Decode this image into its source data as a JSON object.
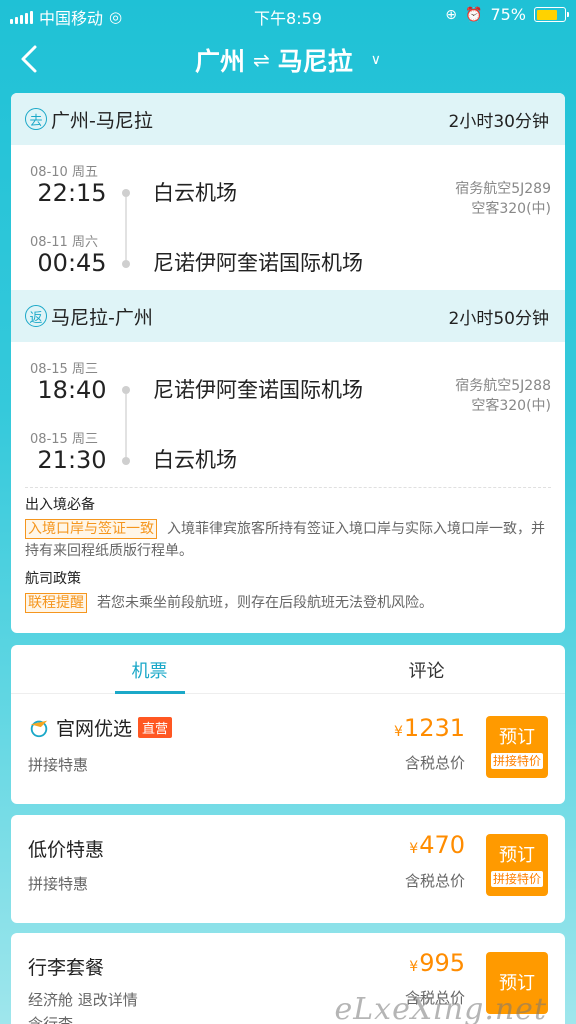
{
  "status_bar": {
    "carrier": "中国移动",
    "time": "下午8:59",
    "battery": "75%",
    "battery_level": 0.75
  },
  "nav": {
    "origin": "广州",
    "swap_icon": "⇌",
    "destination": "马尼拉",
    "dropdown_icon": "∨"
  },
  "outbound": {
    "badge": "去",
    "route": "广州-马尼拉",
    "duration": "2小时30分钟",
    "dep_date": "08-10 周五",
    "dep_time": "22:15",
    "dep_airport": "白云机场",
    "arr_date": "08-11 周六",
    "arr_time": "00:45",
    "arr_airport": "尼诺伊阿奎诺国际机场",
    "carrier": "宿务航空5J289",
    "aircraft": "空客320(中)"
  },
  "inbound": {
    "badge": "返",
    "route": "马尼拉-广州",
    "duration": "2小时50分钟",
    "dep_date": "08-15 周三",
    "dep_time": "18:40",
    "dep_airport": "尼诺伊阿奎诺国际机场",
    "arr_date": "08-15 周三",
    "arr_time": "21:30",
    "arr_airport": "白云机场",
    "carrier": "宿务航空5J288",
    "aircraft": "空客320(中)"
  },
  "notes": {
    "entry_title": "出入境必备",
    "entry_tag": "入境口岸与签证一致",
    "entry_text": "入境菲律宾旅客所持有签证入境口岸与实际入境口岸一致，并持有来回程纸质版行程单。",
    "policy_title": "航司政策",
    "policy_tag": "联程提醒",
    "policy_text": "若您未乘坐前段航班，则存在后段航班无法登机风险。"
  },
  "tabs": {
    "tickets": "机票",
    "reviews": "评论"
  },
  "products": [
    {
      "name": "官网优选",
      "badge": "直营",
      "sub": "拼接特惠",
      "currency": "¥",
      "price": "1231",
      "tax_note": "含税总价",
      "button": "预订",
      "button_tag": "拼接特价"
    },
    {
      "name": "低价特惠",
      "sub": "拼接特惠",
      "currency": "¥",
      "price": "470",
      "tax_note": "含税总价",
      "button": "预订",
      "button_tag": "拼接特价"
    },
    {
      "name": "行李套餐",
      "sub": "经济舱 退改详情",
      "sub2": "含行李",
      "currency": "¥",
      "price": "995",
      "tax_note": "含税总价",
      "button": "预订"
    }
  ],
  "watermark": "eLxeXing.net",
  "colors": {
    "accent": "#1ba8c8",
    "price": "#ff8c00",
    "button": "#ff9a00",
    "badge_direct": "#ff5722"
  }
}
